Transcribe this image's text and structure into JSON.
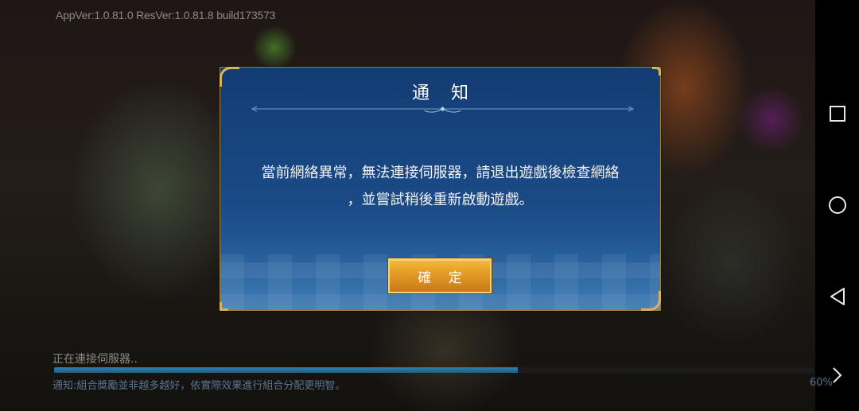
{
  "game": {
    "version_text": "AppVer:1.0.81.0 ResVer:1.0.81.8 build173573"
  },
  "dialog": {
    "title": "通 知",
    "message_line1": "當前網絡異常，無法連接伺服器，請退出遊戲後檢查網絡",
    "message_line2": "，並嘗試稍後重新啟動遊戲。",
    "confirm_label": "確 定"
  },
  "loading": {
    "status": "正在連接伺服器..",
    "tip": "通知:組合獎勵並非越多越好，依實際效果進行組合分配更明智。",
    "percent_text": "60%",
    "progress": 0.61
  },
  "navigation": {
    "recent_apps_icon": "square-icon",
    "home_icon": "circle-icon",
    "back_icon": "triangle-back-icon",
    "next_icon": "chevron-right-icon"
  },
  "colors": {
    "dialog_bg": "#1a4a86",
    "dialog_border": "#a08440",
    "button_gold": "#e39a26",
    "progress_blue": "#2f7fae"
  }
}
